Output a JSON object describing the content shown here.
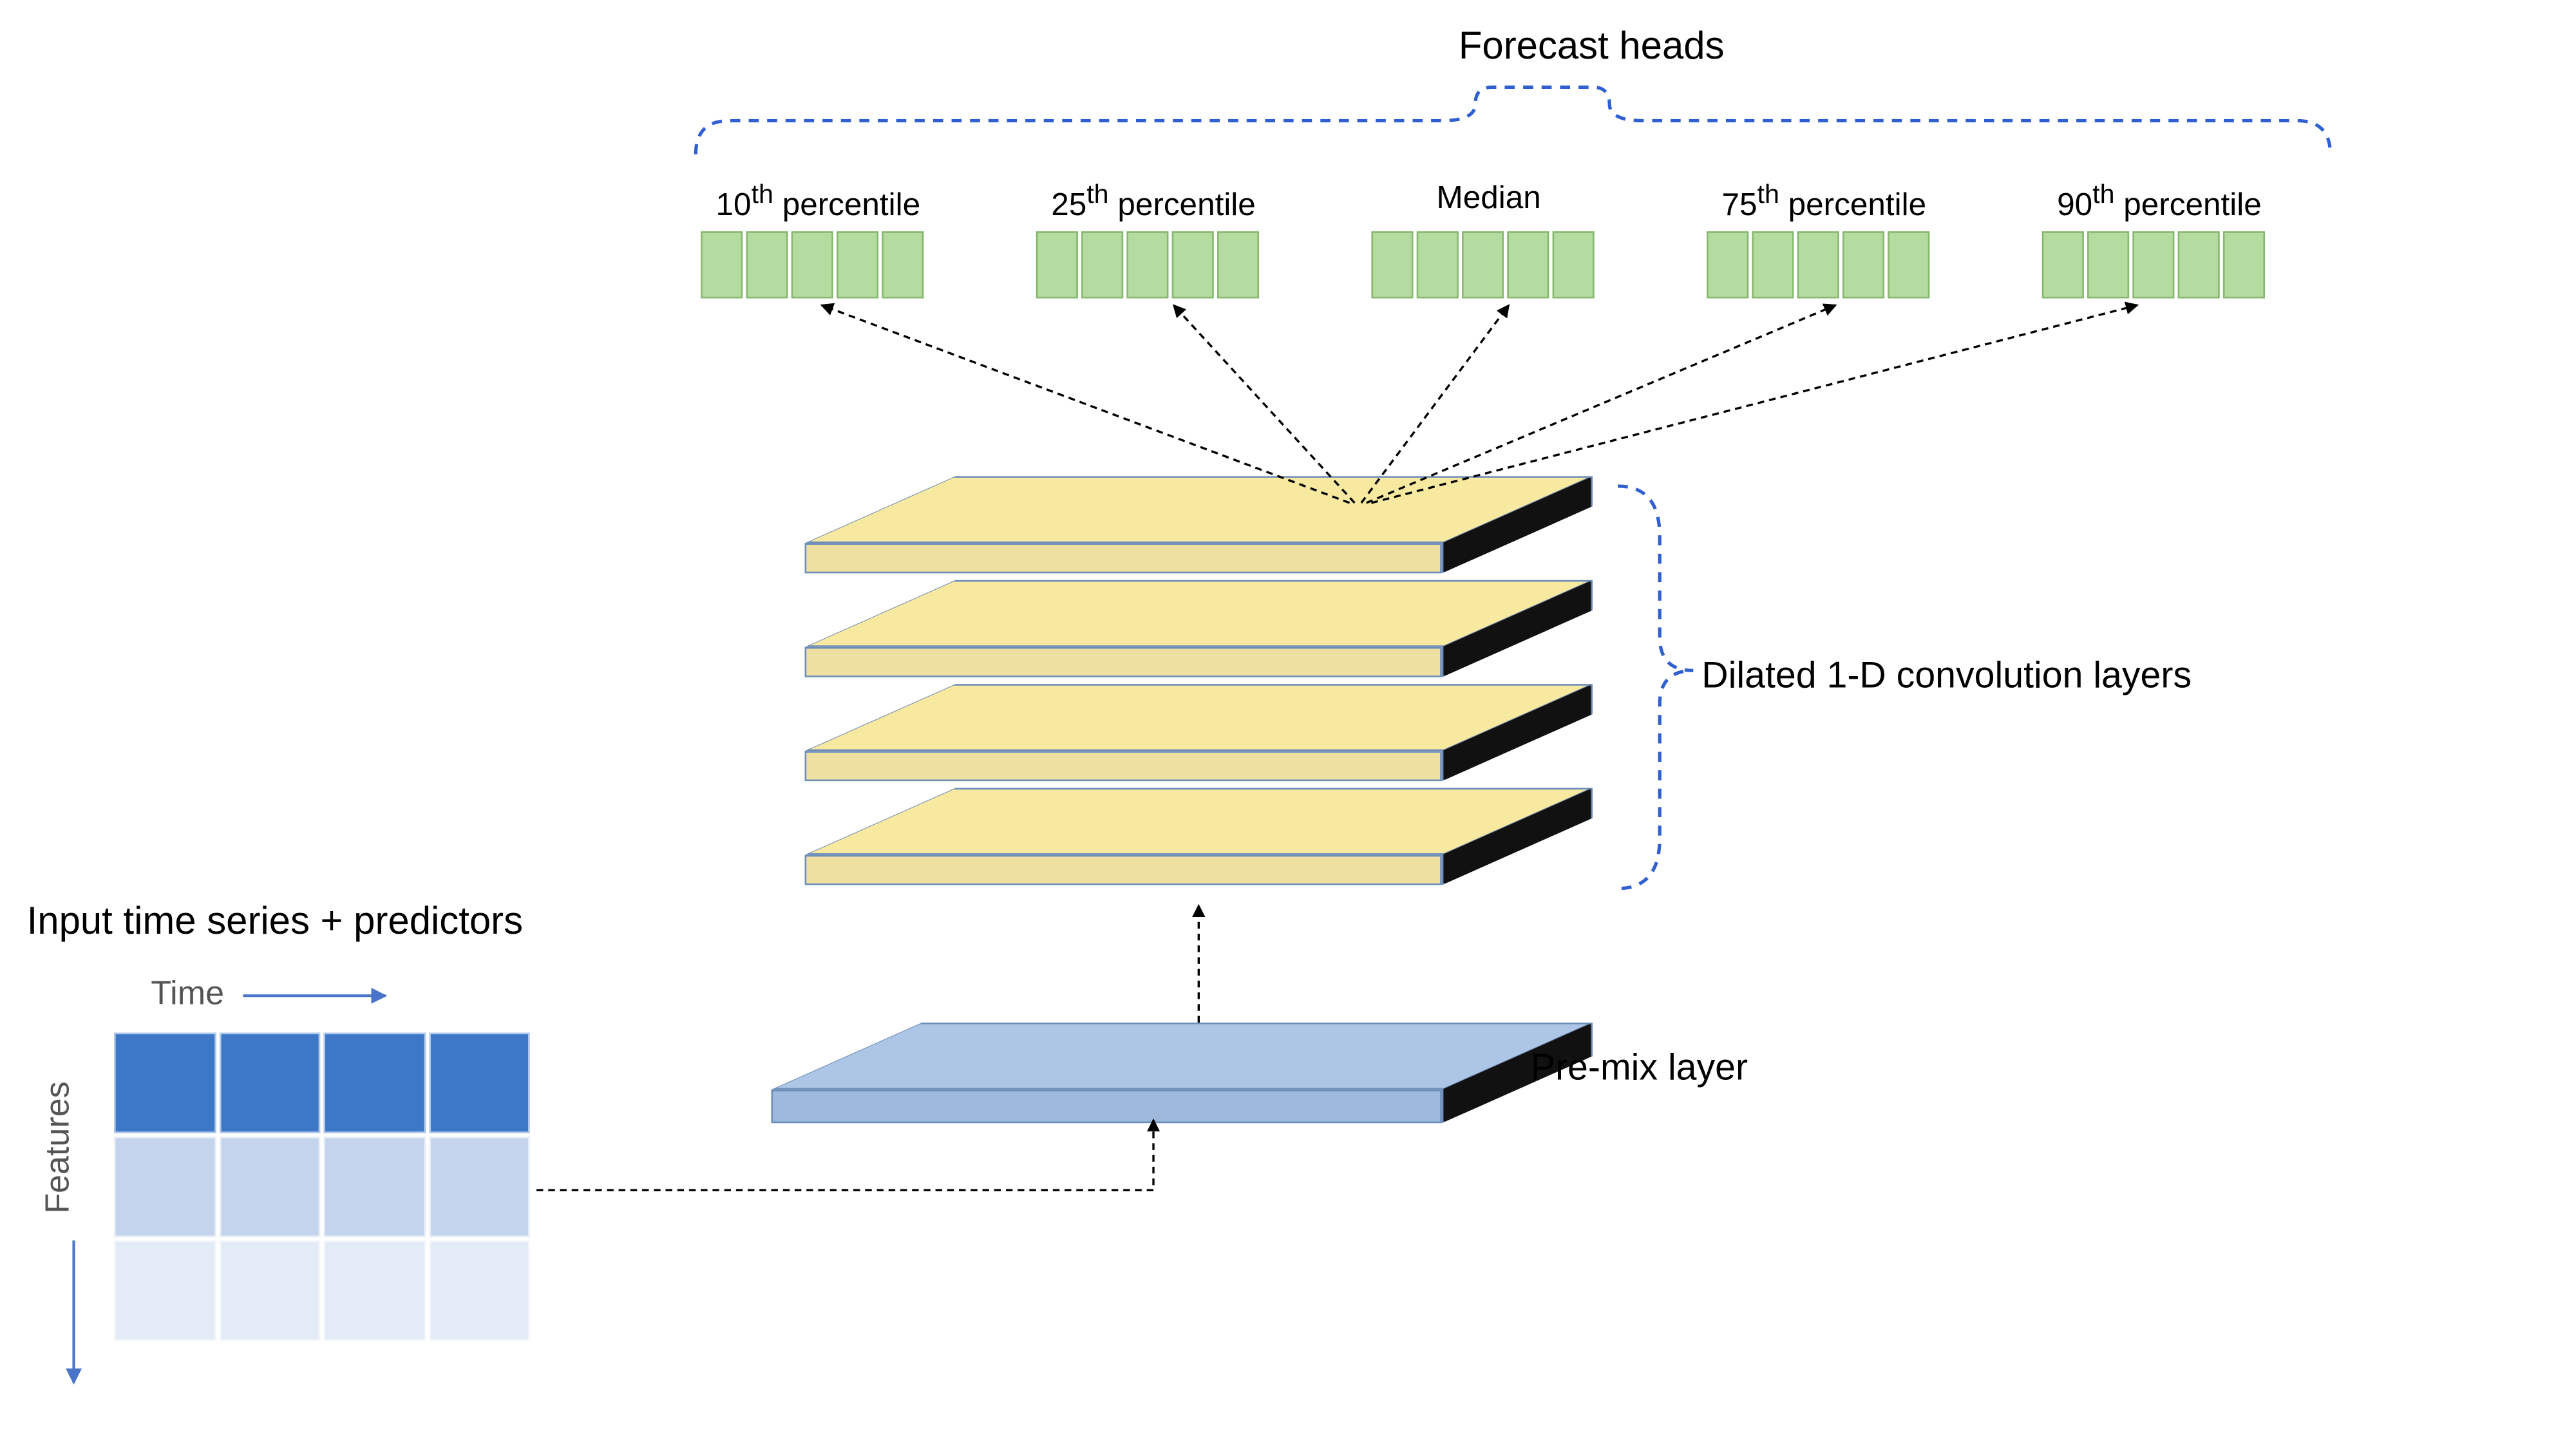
{
  "title": "Forecast heads",
  "forecast_heads": {
    "group_label": "Forecast heads",
    "items": [
      {
        "label_html": "10<sup>th</sup> percentile",
        "cells": 5
      },
      {
        "label_html": "25<sup>th</sup> percentile",
        "cells": 5
      },
      {
        "label_html": "Median",
        "cells": 5
      },
      {
        "label_html": "75<sup>th</sup> percentile",
        "cells": 5
      },
      {
        "label_html": "90<sup>th</sup> percentile",
        "cells": 5
      }
    ]
  },
  "layers": {
    "dilated_label": "Dilated 1-D convolution layers",
    "dilated_count": 4,
    "premix_label": "Pre-mix layer"
  },
  "input": {
    "title": "Input time series + predictors",
    "x_axis": "Time",
    "y_axis": "Features",
    "rows": 3,
    "cols": 4
  },
  "colors": {
    "head_cell": "#b4dca0",
    "dilated_top": "#f7e9a0",
    "dilated_front": "#ede0a0",
    "premix_top": "#aec6e6",
    "premix_front": "#9fb9dc",
    "brace": "#2f5fd0"
  }
}
